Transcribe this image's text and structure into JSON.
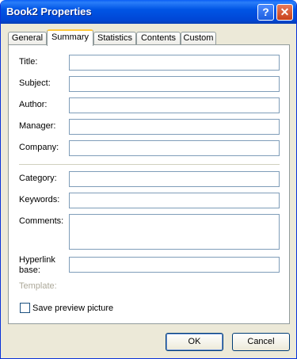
{
  "window": {
    "title": "Book2 Properties",
    "help_glyph": "?",
    "close_glyph": "✕"
  },
  "tabs": [
    "General",
    "Summary",
    "Statistics",
    "Contents",
    "Custom"
  ],
  "active_tab": "Summary",
  "fields": {
    "title": {
      "label": "Title:",
      "value": ""
    },
    "subject": {
      "label": "Subject:",
      "value": ""
    },
    "author": {
      "label": "Author:",
      "value": ""
    },
    "manager": {
      "label": "Manager:",
      "value": ""
    },
    "company": {
      "label": "Company:",
      "value": ""
    },
    "category": {
      "label": "Category:",
      "value": ""
    },
    "keywords": {
      "label": "Keywords:",
      "value": ""
    },
    "comments": {
      "label": "Comments:",
      "value": ""
    },
    "hyperlink_base": {
      "label_line1": "Hyperlink",
      "label_line2": "base:",
      "value": ""
    },
    "template": {
      "label": "Template:"
    }
  },
  "save_preview": {
    "label": "Save preview picture",
    "checked": false
  },
  "buttons": {
    "ok": "OK",
    "cancel": "Cancel"
  }
}
